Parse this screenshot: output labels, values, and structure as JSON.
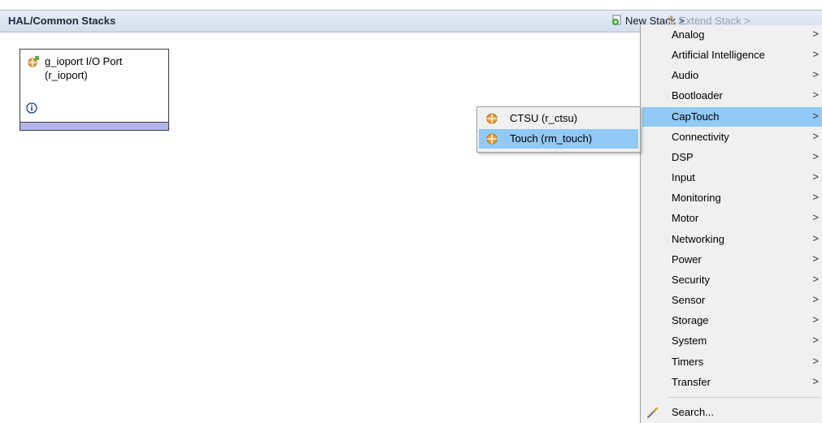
{
  "header": {
    "title": "HAL/Common Stacks",
    "new_stack": "New Stack >",
    "extend_stack": "Extend Stack >"
  },
  "module": {
    "name": "g_ioport I/O Port",
    "driver": "(r_ioport)",
    "bar_color": "#b4b4ec"
  },
  "menu": {
    "items": [
      {
        "label": "Analog",
        "arrow": ">"
      },
      {
        "label": "Artificial Intelligence",
        "arrow": ">"
      },
      {
        "label": "Audio",
        "arrow": ">"
      },
      {
        "label": "Bootloader",
        "arrow": ">"
      },
      {
        "label": "CapTouch",
        "arrow": ">"
      },
      {
        "label": "Connectivity",
        "arrow": ">"
      },
      {
        "label": "DSP",
        "arrow": ">"
      },
      {
        "label": "Input",
        "arrow": ">"
      },
      {
        "label": "Monitoring",
        "arrow": ">"
      },
      {
        "label": "Motor",
        "arrow": ">"
      },
      {
        "label": "Networking",
        "arrow": ">"
      },
      {
        "label": "Power",
        "arrow": ">"
      },
      {
        "label": "Security",
        "arrow": ">"
      },
      {
        "label": "Sensor",
        "arrow": ">"
      },
      {
        "label": "Storage",
        "arrow": ">"
      },
      {
        "label": "System",
        "arrow": ">"
      },
      {
        "label": "Timers",
        "arrow": ">"
      },
      {
        "label": "Transfer",
        "arrow": ">"
      }
    ],
    "search_label": "Search...",
    "highlight_color": "#91c9f7"
  },
  "submenu": {
    "items": [
      {
        "label": "CTSU (r_ctsu)"
      },
      {
        "label": "Touch (rm_touch)"
      }
    ]
  }
}
